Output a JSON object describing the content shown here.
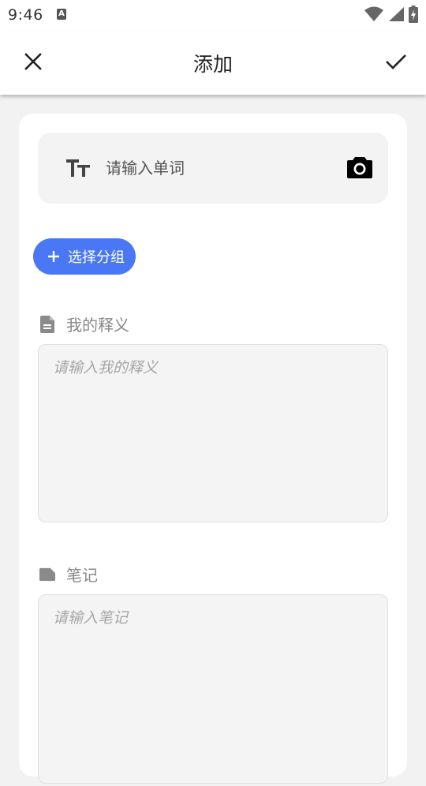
{
  "status_bar": {
    "time": "9:46",
    "notification_icon": "a-notification-icon",
    "icons": [
      "wifi-icon",
      "cell-signal-icon",
      "battery-charging-icon"
    ]
  },
  "app_bar": {
    "title": "添加",
    "close_icon": "close-icon",
    "confirm_icon": "check-icon"
  },
  "word": {
    "placeholder": "请输入单词",
    "value": "",
    "leading_icon": "text-size-icon",
    "trailing_icon": "camera-icon"
  },
  "group_button": {
    "label": "选择分组",
    "icon": "plus-icon",
    "color": "#4a78f5"
  },
  "definition": {
    "label": "我的释义",
    "icon": "document-icon",
    "placeholder": "请输入我的释义",
    "value": ""
  },
  "notes": {
    "label": "笔记",
    "icon": "note-icon",
    "placeholder": "请输入笔记",
    "value": ""
  }
}
